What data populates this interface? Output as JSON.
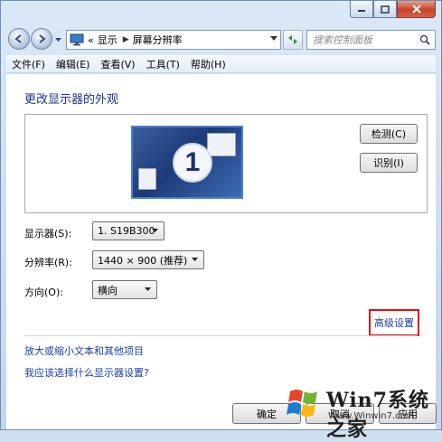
{
  "window": {
    "caption_buttons": [
      "minimize",
      "maximize",
      "close"
    ]
  },
  "nav": {
    "address_prefix": "«",
    "breadcrumb": [
      "显示",
      "屏幕分辨率"
    ],
    "search_placeholder": "搜索控制面板"
  },
  "menu": {
    "items": [
      "文件(F)",
      "编辑(E)",
      "查看(V)",
      "工具(T)",
      "帮助(H)"
    ]
  },
  "main": {
    "title": "更改显示器的外观",
    "monitor_number": "1",
    "detect_label": "检测(C)",
    "identify_label": "识别(I)",
    "display_label": "显示器(S):",
    "display_value": "1. S19B300",
    "resolution_label": "分辨率(R):",
    "resolution_value": "1440 × 900 (推荐)",
    "orientation_label": "方向(O):",
    "orientation_value": "横向",
    "advanced_link": "高级设置",
    "link_text_size": "放大或缩小文本和其他项目",
    "link_which_settings": "我应该选择什么显示器设置?"
  },
  "footer": {
    "ok_label": "确定",
    "cancel_label": "取消",
    "apply_label": "应用"
  },
  "watermark": {
    "brand_text": "Win7系统之家",
    "url": "Www.Winwin7.com"
  },
  "colors": {
    "link": "#1a3fa8",
    "title": "#1e3287",
    "highlight_border": "#e01010"
  }
}
